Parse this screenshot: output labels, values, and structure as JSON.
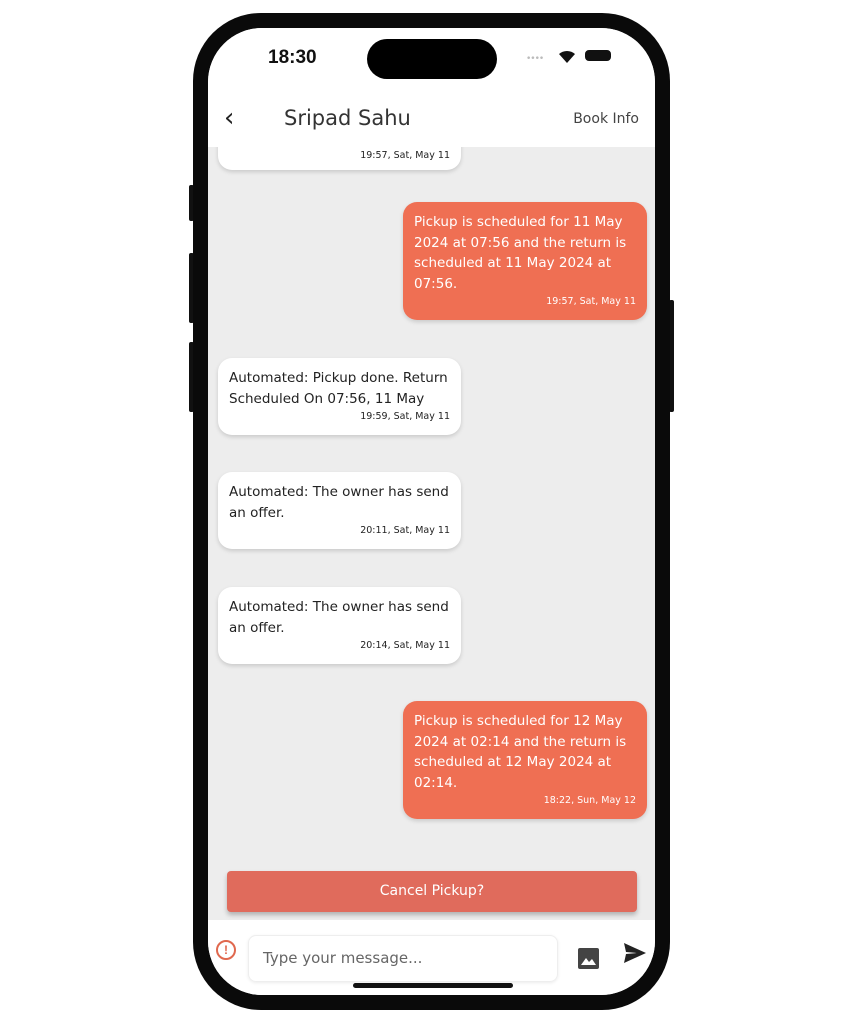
{
  "status": {
    "time": "18:30"
  },
  "header": {
    "title": "Sripad Sahu",
    "book_info": "Book Info"
  },
  "messages": [
    {
      "side": "in",
      "text": "",
      "time": "19:57, Sat, May 11"
    },
    {
      "side": "out",
      "text": "Pickup is scheduled for 11 May 2024 at 07:56 and the return is scheduled at 11 May 2024 at 07:56.",
      "time": "19:57, Sat, May 11"
    },
    {
      "side": "in",
      "text": "Automated: Pickup done. Return Scheduled On 07:56, 11 May",
      "time": "19:59, Sat, May 11"
    },
    {
      "side": "in",
      "text": "Automated: The owner has send an offer.",
      "time": "20:11, Sat, May 11"
    },
    {
      "side": "in",
      "text": "Automated: The owner has send an offer.",
      "time": "20:14, Sat, May 11"
    },
    {
      "side": "out",
      "text": "Pickup is scheduled for 12 May 2024 at 02:14 and the return is scheduled at 12 May 2024 at 02:14.",
      "time": "18:22, Sun, May 12"
    }
  ],
  "cancel_label": "Cancel Pickup?",
  "composer": {
    "placeholder": "Type your message..."
  },
  "colors": {
    "accent": "#ef6f53",
    "cancel": "#e06b5c"
  }
}
